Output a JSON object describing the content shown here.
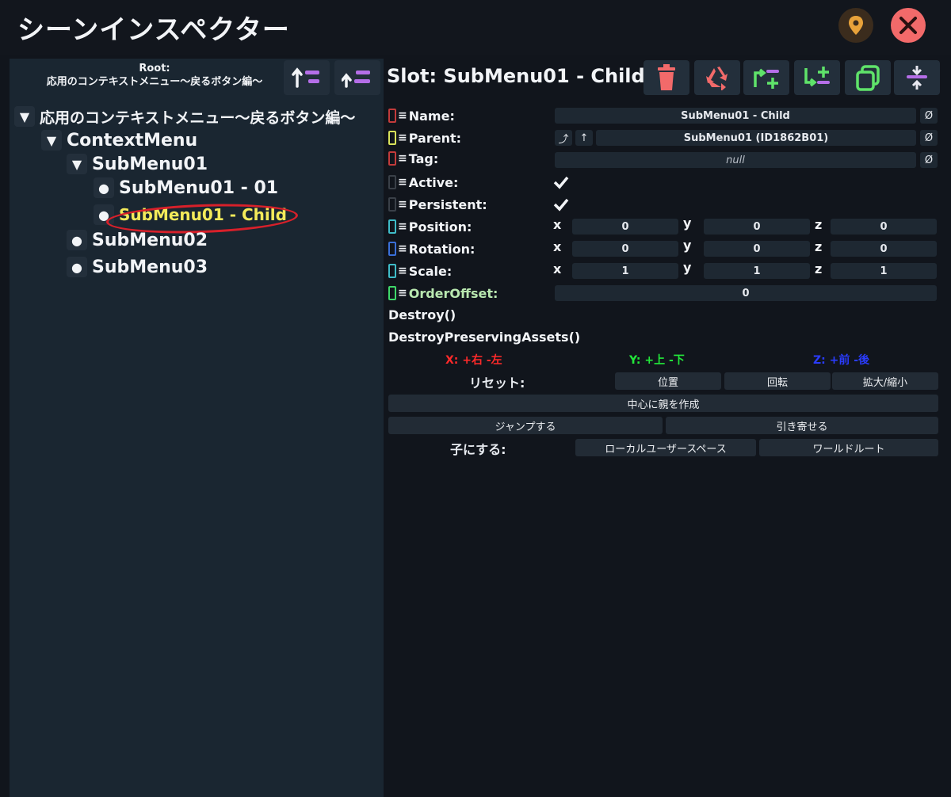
{
  "window": {
    "title": "シーンインスペクター",
    "pin_icon": "location-pin-icon",
    "close_icon": "close-icon",
    "colors": {
      "close": "#f26a6a",
      "pin": "#e8a23a",
      "selected_text": "#f3ea5a",
      "annotation_ring": "#d8202a"
    }
  },
  "hierarchy": {
    "root_caption": "Root:",
    "root_name": "応用のコンテキストメニュー～戻るボタン編～",
    "buttons": [
      {
        "icon": "move-up-to-root-icon"
      },
      {
        "icon": "move-up-level-icon"
      }
    ],
    "tree": [
      {
        "label": "応用のコンテキストメニュー～戻るボタン編～",
        "toggle": "▼"
      },
      {
        "label": "ContextMenu",
        "toggle": "▼"
      },
      {
        "label": "SubMenu01",
        "toggle": "▼"
      },
      {
        "label": "SubMenu01 - 01",
        "toggle": "●"
      },
      {
        "label": "SubMenu01 - Child",
        "toggle": "●",
        "selected": true
      },
      {
        "label": "SubMenu02",
        "toggle": "●"
      },
      {
        "label": "SubMenu03",
        "toggle": "●"
      }
    ]
  },
  "inspector": {
    "slot_title": "Slot: SubMenu01 - Child",
    "toolbar": [
      {
        "icon": "trash-icon"
      },
      {
        "icon": "recycle-icon"
      },
      {
        "icon": "insert-parent-icon"
      },
      {
        "icon": "add-child-icon"
      },
      {
        "icon": "duplicate-icon"
      },
      {
        "icon": "center-pivot-icon"
      }
    ],
    "fields": {
      "name_label": "Name:",
      "name_value": "SubMenu01 - Child",
      "parent_label": "Parent:",
      "parent_value": "SubMenu01 (ID1862B01)",
      "tag_label": "Tag:",
      "tag_value": "null",
      "active_label": "Active:",
      "persistent_label": "Persistent:",
      "position_label": "Position:",
      "rotation_label": "Rotation:",
      "scale_label": "Scale:",
      "order_offset_label": "OrderOffset:",
      "order_offset_value": "0",
      "null_symbol": "Ø",
      "parent_jump_symbol": "⤴",
      "parent_up_symbol": "↑"
    },
    "checks": {
      "active": true,
      "persistent": true
    },
    "axes": [
      "x",
      "y",
      "z"
    ],
    "position": [
      "0",
      "0",
      "0"
    ],
    "rotation": [
      "0",
      "0",
      "0"
    ],
    "scale": [
      "1",
      "1",
      "1"
    ],
    "methods": [
      "Destroy()",
      "DestroyPreservingAssets()"
    ],
    "axis_hints": [
      {
        "text": "X: +右 -左",
        "color": "#ff2a2a"
      },
      {
        "text": "Y: +上 -下",
        "color": "#22e83a"
      },
      {
        "text": "Z: +前 -後",
        "color": "#2a3cff"
      }
    ],
    "reset_label": "リセット:",
    "reset_buttons": [
      "位置",
      "回転",
      "拡大/縮小"
    ],
    "create_parent": "中心に親を作成",
    "jump_to": "ジャンプする",
    "bring_to": "引き寄せる",
    "make_child_label": "子にする:",
    "make_child_buttons": [
      "ローカルユーザースペース",
      "ワールドルート"
    ]
  }
}
